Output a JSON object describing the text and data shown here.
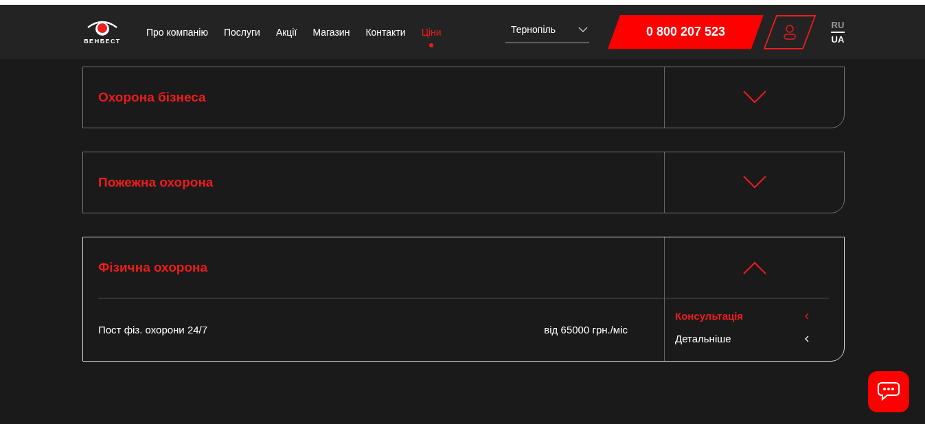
{
  "header": {
    "logo": "ВЕНБЕСТ",
    "nav": [
      {
        "label": "Про компанію",
        "selected": false
      },
      {
        "label": "Послуги",
        "selected": false
      },
      {
        "label": "Акції",
        "selected": false
      },
      {
        "label": "Магазин",
        "selected": false
      },
      {
        "label": "Контакти",
        "selected": false
      },
      {
        "label": "Ціни",
        "selected": true
      }
    ],
    "city": "Тернопіль",
    "phone": "0 800 207 523",
    "languages": [
      {
        "label": "RU",
        "selected": false
      },
      {
        "label": "UA",
        "selected": true
      }
    ]
  },
  "sections": [
    {
      "title": "Охорона бізнеса",
      "expanded": false
    },
    {
      "title": "Пожежна охорона",
      "expanded": false
    },
    {
      "title": "Фізична охорона",
      "expanded": true,
      "rows": [
        {
          "name": "Пост фіз. охорони 24/7",
          "price": "від 65000 грн./міс",
          "actions": [
            {
              "label": "Консультація",
              "kind": "primary"
            },
            {
              "label": "Детальніше",
              "kind": "secondary"
            }
          ]
        }
      ]
    }
  ]
}
